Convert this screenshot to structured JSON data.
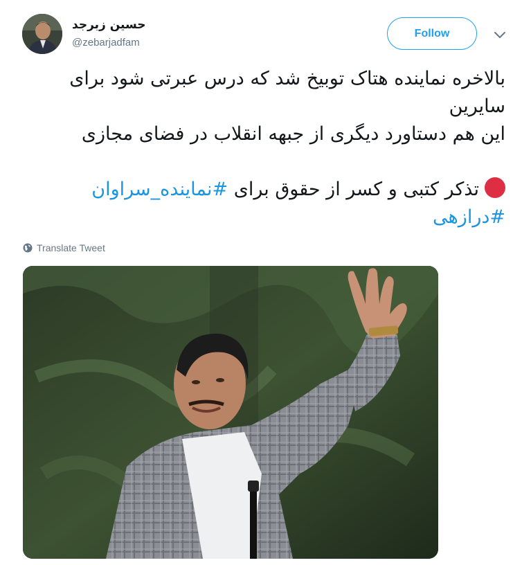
{
  "user": {
    "name": "حسین زبرجد",
    "handle": "@zebarjadfam"
  },
  "follow_label": "Follow",
  "tweet": {
    "line1": "بالاخره نماینده هتاک توبیخ شد که درس عبرتی شود برای",
    "line2": "سایرین",
    "line3": "این هم دستاورد دیگری از جبهه انقلاب در فضای مجازی",
    "line4_text": "تذکر کتبی و کسر از حقوق برای ",
    "hashtag1": "#نماینده_سراوان",
    "hashtag2": "#درازهی"
  },
  "translate_label": "Translate Tweet",
  "icons": {
    "globe": "globe-icon",
    "chevron": "chevron-down-icon",
    "red_circle": "red-circle-emoji"
  },
  "colors": {
    "accent": "#1da1f2",
    "hashtag": "#1b95e0",
    "secondary_text": "#657786",
    "emoji_red": "#dd2e44"
  }
}
